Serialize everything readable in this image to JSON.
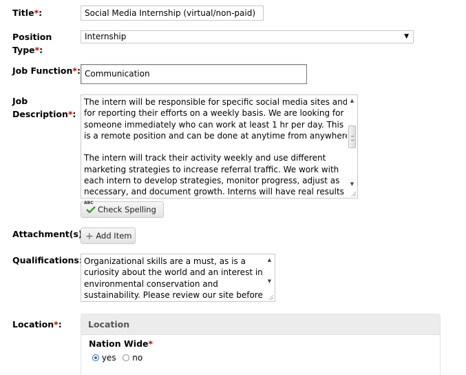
{
  "form": {
    "title_label": "Title",
    "title_value": "Social Media Internship (virtual/non-paid)",
    "position_type_label_1": "Position",
    "position_type_label_2": "Type",
    "position_type_value": "Internship",
    "job_function_label": "Job Function",
    "job_function_value": "Communication",
    "job_description_label_1": "Job",
    "job_description_label_2": "Description",
    "job_description_lines_1": [
      "The intern will be responsible for specific social media sites and",
      "for reporting their efforts on a weekly basis. We are looking for",
      "someone immediately who can work at least 1 hr per day. This",
      "is a remote position and can be done at anytime from anywhere."
    ],
    "job_description_lines_2": [
      "The intern will track their activity weekly and use different",
      "marketing strategies to increase referral traffic. We work with",
      "each intern to develop strategies, monitor progress, adjust as",
      "necessary, and document growth. Interns will have real results to"
    ],
    "check_spelling_label": "Check Spelling",
    "spell_icon_text": "ABC",
    "attachments_label": "Attachment(s):",
    "add_item_label": "Add Item",
    "qualifications_label": "Qualifications:",
    "qualifications_lines": [
      "Organizational skills are a must, as is  a",
      "curiosity about the world and an interest in",
      "environmental conservation and",
      "sustainability. Please review our site before"
    ],
    "location_label": "Location",
    "required_mark": "*",
    "colon": ":",
    "location_panel_title": "Location",
    "nation_wide_label": "Nation Wide",
    "radio_yes": "yes",
    "radio_no": "no",
    "nation_wide_selected": "yes"
  },
  "icons": {
    "select_arrow": "chevron-down-icon",
    "add": "plus-icon",
    "spell": "spell-check-icon"
  },
  "colors": {
    "required": "#c00000",
    "radio_selected": "#2a6cc0",
    "panel_header_bg": "#ececec"
  }
}
